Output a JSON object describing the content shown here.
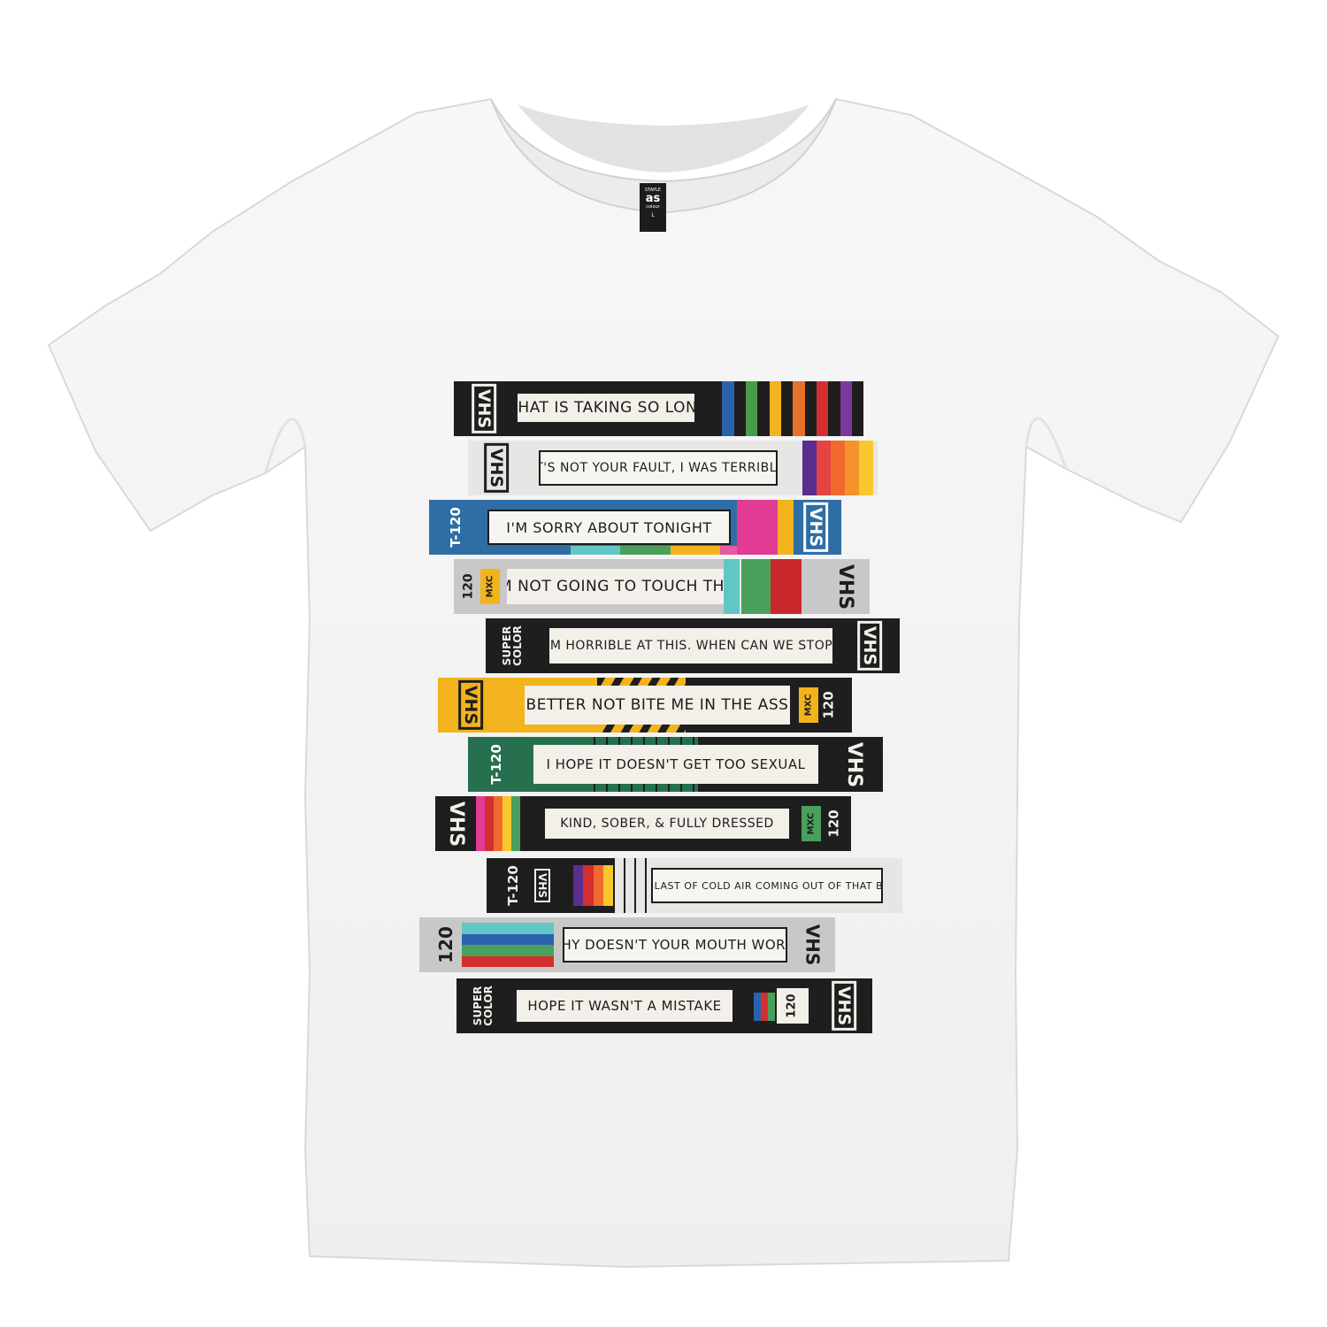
{
  "colors": {
    "black": "#1e1e1e",
    "grey": "#c8c8c8",
    "light": "#e6e6e4",
    "blue": "#2e6ea4",
    "yellow": "#f2b31c",
    "green": "#26704f",
    "cream": "#f2f0e8"
  },
  "shirt": {
    "tag": {
      "brand": "as",
      "sub": "colour",
      "top": "STAPLE",
      "size": "L"
    }
  },
  "tapes": [
    {
      "title": "WHAT IS TAKING SO LONG",
      "spine": "VHS"
    },
    {
      "title": "IT'S NOT YOUR FAULT, I WAS TERRIBLE",
      "spine": "VHS"
    },
    {
      "title": "I'M SORRY ABOUT TONIGHT",
      "code": "T-120",
      "spine": "VHS"
    },
    {
      "title": "I'M NOT GOING TO TOUCH THAT",
      "code": "120",
      "tag": "MXC",
      "spine": "VHS"
    },
    {
      "title": "I'M HORRIBLE AT THIS. WHEN CAN WE STOP?",
      "brand": "SUPER COLOR",
      "spine": "VHS"
    },
    {
      "title": "BETTER NOT BITE ME IN THE ASS",
      "code": "120",
      "tag": "MXC",
      "spine": "VHS"
    },
    {
      "title": "I HOPE IT DOESN'T GET TOO SEXUAL",
      "code": "T-120",
      "spine": "VHS"
    },
    {
      "title": "KIND, SOBER, & FULLY DRESSED",
      "code": "120",
      "tag": "MXC",
      "spine": "VHS"
    },
    {
      "title": "A BLAST OF COLD AIR COMING OUT OF THAT BOX",
      "code": "T-120",
      "spine": "VHS"
    },
    {
      "title": "WHY DOESN'T YOUR MOUTH WORK?",
      "code": "120",
      "spine": "VHS"
    },
    {
      "title": "HOPE IT WASN'T A MISTAKE",
      "brand": "SUPER COLOR",
      "code": "120",
      "spine": "VHS"
    }
  ]
}
